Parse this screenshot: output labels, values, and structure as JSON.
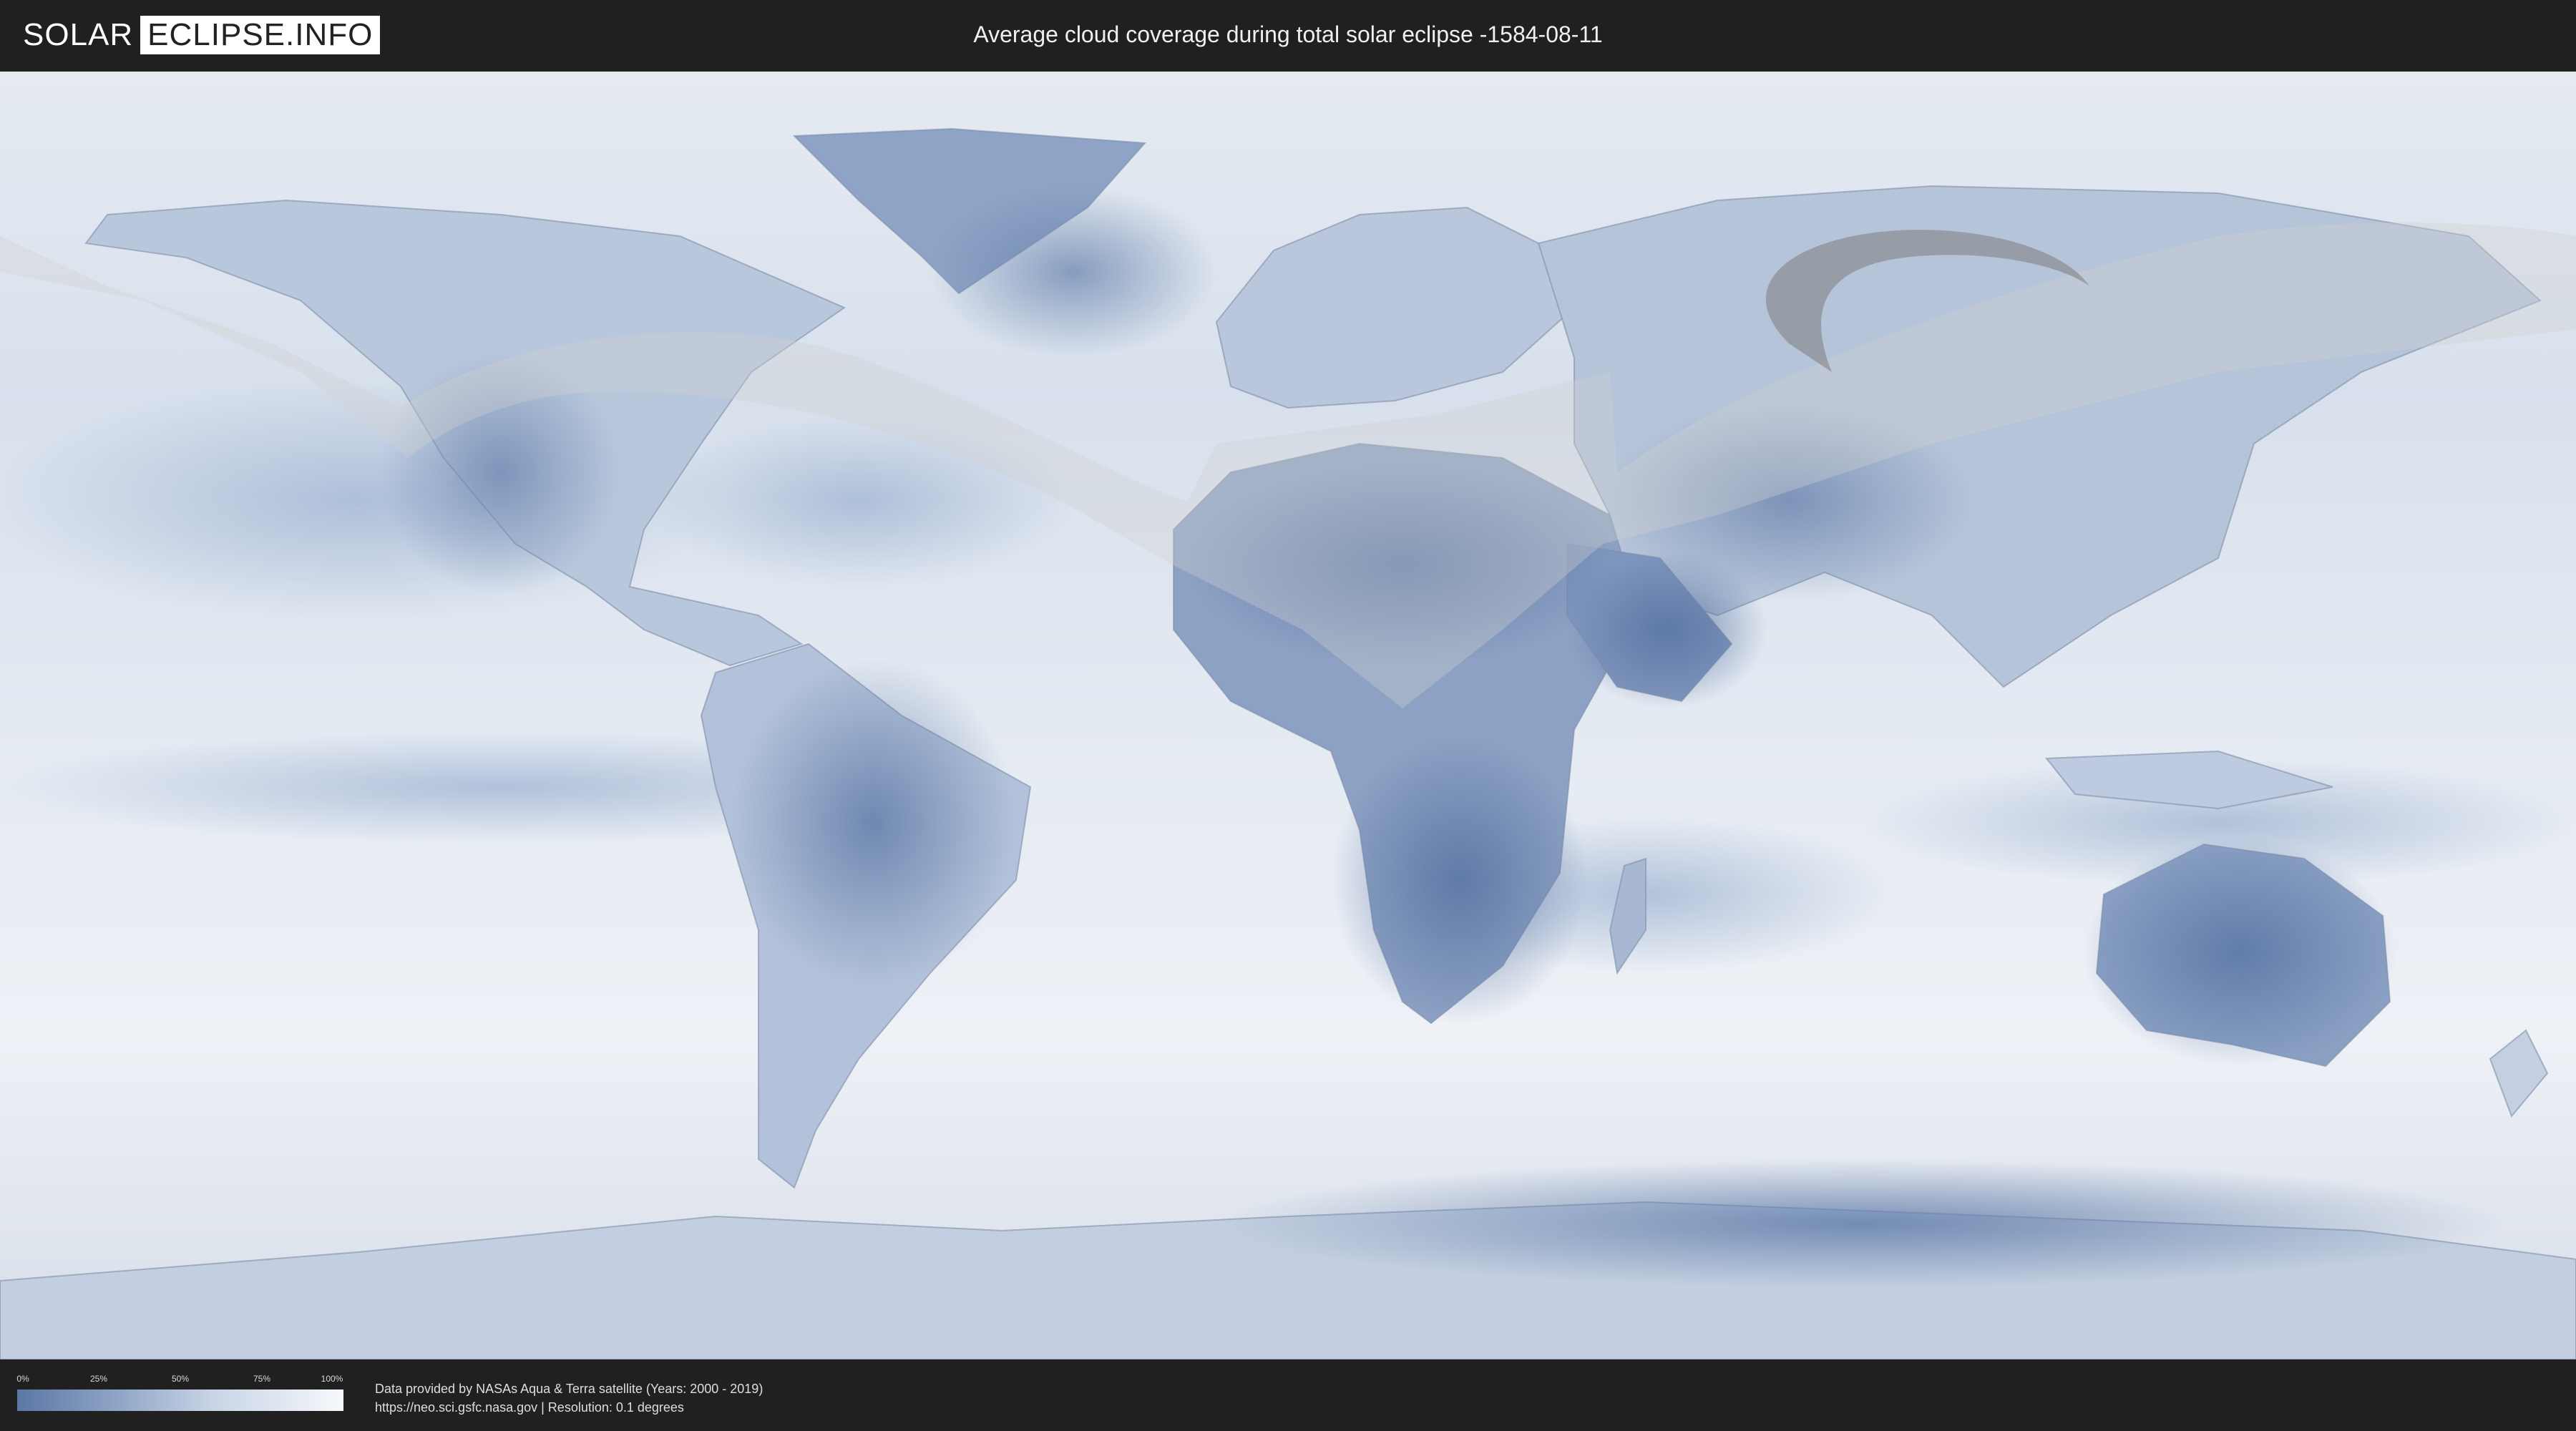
{
  "logo": {
    "part1": "SOLAR",
    "part2": "ECLIPSE.INFO"
  },
  "title": "Average cloud coverage during total solar eclipse -1584-08-11",
  "legend": {
    "ticks": [
      "0%",
      "25%",
      "50%",
      "75%",
      "100%"
    ],
    "colors": {
      "low": "#5b77a4",
      "high": "#f6f8fb"
    }
  },
  "credits": {
    "line1": "Data provided by NASAs Aqua & Terra satellite (Years: 2000 - 2019)",
    "line2": "https://neo.sci.gsfc.nasa.gov | Resolution: 0.1 degrees"
  },
  "map": {
    "projection": "equirectangular",
    "colors": {
      "clear": "#5873a2",
      "cloudy": "#f4f6fa",
      "shadow": "rgba(210,210,210,0.35)",
      "path": "rgba(120,120,120,0.55)"
    }
  }
}
